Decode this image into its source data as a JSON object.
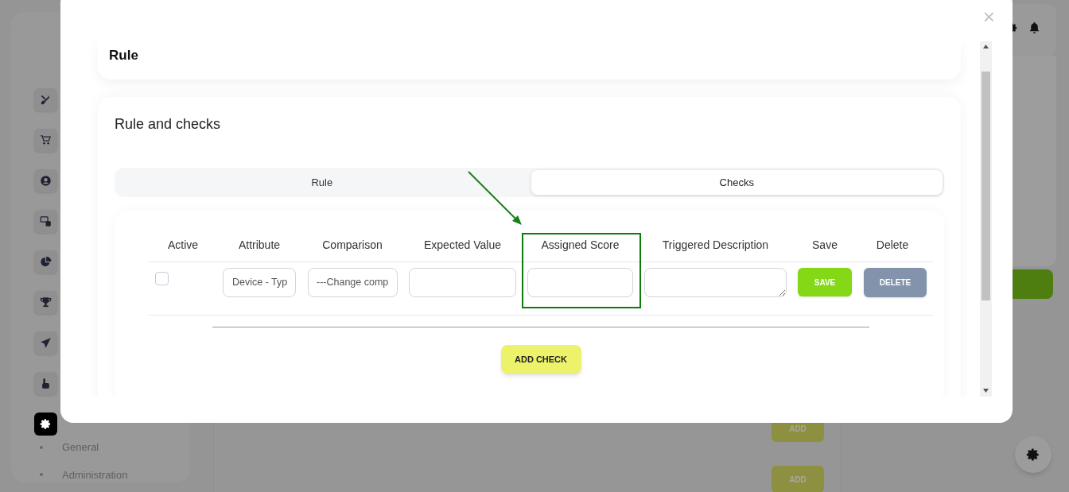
{
  "background": {
    "sidebar": {
      "items": [
        {
          "selected": false
        },
        {
          "selected": false
        },
        {
          "selected": false
        },
        {
          "selected": false
        },
        {
          "selected": false
        },
        {
          "selected": false
        },
        {
          "selected": false
        },
        {
          "selected": false
        },
        {
          "selected": true
        }
      ],
      "submenu": [
        "General",
        "Administration"
      ]
    },
    "add_buttons": [
      "ADD",
      "ADD"
    ]
  },
  "modal": {
    "close": "×",
    "rule_card": {
      "title": "Rule"
    },
    "checks_card": {
      "title": "Rule and checks",
      "tabs": [
        {
          "label": "Rule",
          "selected": false
        },
        {
          "label": "Checks",
          "selected": true
        }
      ],
      "table": {
        "columns": [
          "Active",
          "Attribute",
          "Comparison",
          "Expected Value",
          "Assigned Score",
          "Triggered Description",
          "Save",
          "Delete"
        ],
        "rows": [
          {
            "active": false,
            "attribute": "Device - Typ",
            "comparison": "---Change comp",
            "save": "SAVE",
            "delete": "DELETE"
          }
        ]
      },
      "add_button": "ADD CHECK"
    }
  }
}
